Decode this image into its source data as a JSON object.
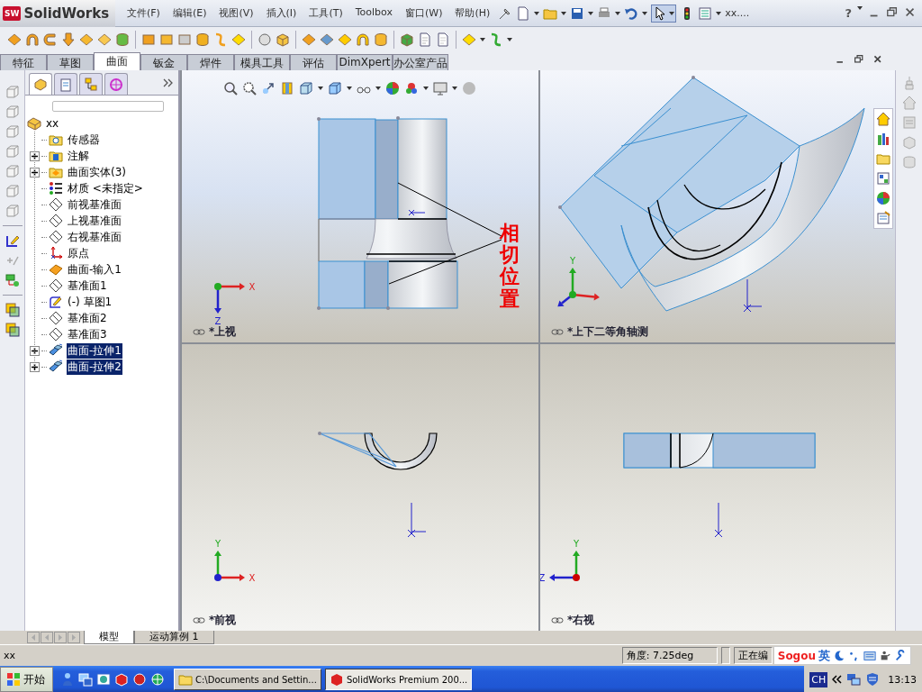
{
  "app": {
    "logo_badge": "SW",
    "logo": "SolidWorks",
    "menus": [
      "文件(F)",
      "编辑(E)",
      "视图(V)",
      "插入(I)",
      "工具(T)",
      "Toolbox",
      "窗口(W)",
      "帮助(H)"
    ],
    "document": "xx....",
    "help": "?"
  },
  "command_tabs": [
    {
      "label": "特征",
      "selected": false
    },
    {
      "label": "草图",
      "selected": false
    },
    {
      "label": "曲面",
      "selected": true
    },
    {
      "label": "钣金",
      "selected": false
    },
    {
      "label": "焊件",
      "selected": false
    },
    {
      "label": "模具工具",
      "selected": false
    },
    {
      "label": "评估",
      "selected": false
    },
    {
      "label": "DimXpert",
      "selected": false
    },
    {
      "label": "办公室产品",
      "selected": false
    }
  ],
  "feature_tree": {
    "label": "xx",
    "children": [
      {
        "label": "传感器",
        "kind": "sensor-folder",
        "selected": false
      },
      {
        "label": "注解",
        "kind": "annotation-folder",
        "expanded": false,
        "selected": false
      },
      {
        "label": "曲面实体(3)",
        "kind": "solid-folder",
        "expanded": false,
        "selected": false
      },
      {
        "label": "材质 <未指定>",
        "kind": "material",
        "selected": false
      },
      {
        "label": "前视基准面",
        "kind": "plane",
        "selected": false
      },
      {
        "label": "上视基准面",
        "kind": "plane",
        "selected": false
      },
      {
        "label": "右视基准面",
        "kind": "plane",
        "selected": false
      },
      {
        "label": "原点",
        "kind": "origin",
        "selected": false
      },
      {
        "label": "曲面-输入1",
        "kind": "imported-surface",
        "selected": false
      },
      {
        "label": "基准面1",
        "kind": "plane",
        "selected": false
      },
      {
        "label": "(-) 草图1",
        "kind": "sketch",
        "selected": false
      },
      {
        "label": "基准面2",
        "kind": "plane",
        "selected": false
      },
      {
        "label": "基准面3",
        "kind": "plane",
        "selected": false
      },
      {
        "label": "曲面-拉伸1",
        "kind": "extruded-surface",
        "expanded": false,
        "selected": true
      },
      {
        "label": "曲面-拉伸2",
        "kind": "extruded-surface",
        "expanded": false,
        "selected": true
      }
    ]
  },
  "viewports": [
    {
      "kind": "top",
      "label": "*上视",
      "triad_axes": [
        "X",
        "Z"
      ]
    },
    {
      "kind": "iso",
      "label": "*上下二等角轴测",
      "triad_axes": [
        "Y"
      ]
    },
    {
      "kind": "front",
      "label": "*前视",
      "triad_axes": [
        "Y",
        "X"
      ]
    },
    {
      "kind": "right",
      "label": "*右视",
      "triad_axes": [
        "Y",
        "Z"
      ]
    }
  ],
  "annotation": {
    "text": "相切位置"
  },
  "bottom_tabs": [
    {
      "label": "模型",
      "selected": true
    },
    {
      "label": "运动算例 1",
      "selected": false
    }
  ],
  "status_bar": {
    "document": "xx",
    "angle": "角度: 7.25deg",
    "mode": "正在编"
  },
  "ime": {
    "logo": "Sogou",
    "mode": "英"
  },
  "taskbar": {
    "start": "开始",
    "windows": [
      {
        "label": "C:\\Documents and Settin...",
        "selected": false
      },
      {
        "label": "SolidWorks Premium 200...",
        "selected": true
      }
    ],
    "language": "CH",
    "clock": "13:13"
  }
}
